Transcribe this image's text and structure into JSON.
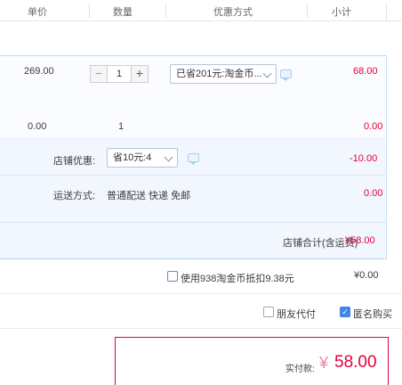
{
  "columns": {
    "unit_price": "单价",
    "quantity": "数量",
    "discount_method": "优惠方式",
    "subtotal": "小计"
  },
  "item1": {
    "unit_price": "269.00",
    "quantity_minus": "−",
    "quantity_value": "1",
    "quantity_plus": "+",
    "discount_select": "已省201元:淘金币...",
    "subtotal": "68.00"
  },
  "item2": {
    "unit_price": "0.00",
    "quantity": "1",
    "subtotal": "0.00"
  },
  "shop": {
    "discount_label": "店铺优惠:",
    "discount_select": "省10元:4",
    "discount_amount": "-10.00",
    "shipping_label": "运送方式:",
    "shipping_value": "普通配送 快递 免邮",
    "shipping_amount": "0.00",
    "total_label": "店铺合计(含运费)",
    "total_amount": "¥58.00"
  },
  "coins": {
    "label": "使用938淘金币抵扣9.38元",
    "amount": "¥0.00"
  },
  "options": {
    "friend_pay": "朋友代付",
    "anonymous": "匿名购买",
    "anonymous_checked": true,
    "friend_pay_checked": false
  },
  "payment": {
    "label": "实付款:",
    "currency": "¥",
    "amount": "58.00"
  },
  "colors": {
    "accent_red": "#e4003a",
    "accent_blue": "#3f86e6"
  }
}
